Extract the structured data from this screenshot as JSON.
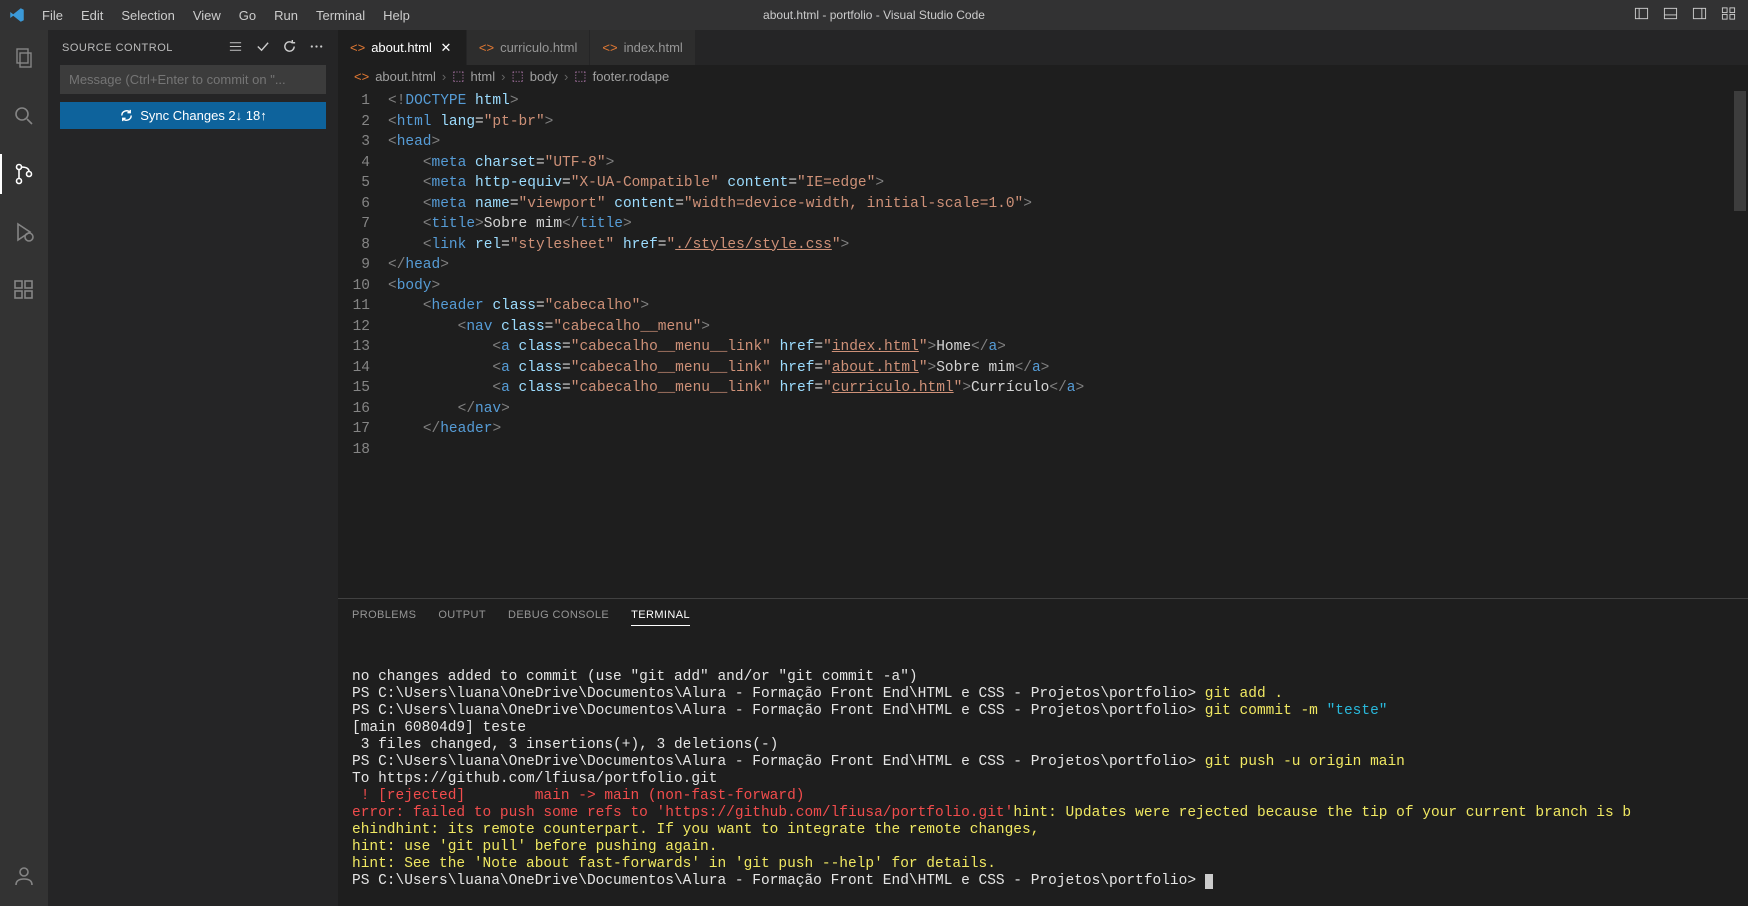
{
  "title": "about.html - portfolio - Visual Studio Code",
  "menu": [
    "File",
    "Edit",
    "Selection",
    "View",
    "Go",
    "Run",
    "Terminal",
    "Help"
  ],
  "sidebar": {
    "header": "SOURCE CONTROL",
    "commit_placeholder": "Message (Ctrl+Enter to commit on \"...",
    "sync_label": "Sync Changes 2↓ 18↑"
  },
  "tabs": [
    {
      "label": "about.html",
      "active": true,
      "close": true
    },
    {
      "label": "curriculo.html",
      "active": false,
      "close": false
    },
    {
      "label": "index.html",
      "active": false,
      "close": false
    }
  ],
  "breadcrumbs": [
    "about.html",
    "html",
    "body",
    "footer.rodape"
  ],
  "gutter_lines": [
    "1",
    "2",
    "3",
    "4",
    "5",
    "6",
    "7",
    "8",
    "9",
    "10",
    "11",
    "12",
    "13",
    "14",
    "15",
    "16",
    "17",
    "18"
  ],
  "panel_tabs": [
    "PROBLEMS",
    "OUTPUT",
    "DEBUG CONSOLE",
    "TERMINAL"
  ],
  "terminal": {
    "l1": "no changes added to commit (use \"git add\" and/or \"git commit -a\")",
    "l2a": "PS C:\\Users\\luana\\OneDrive\\Documentos\\Alura - Formação Front End\\HTML e CSS - Projetos\\portfolio> ",
    "l2b": "git add .",
    "l3a": "PS C:\\Users\\luana\\OneDrive\\Documentos\\Alura - Formação Front End\\HTML e CSS - Projetos\\portfolio> ",
    "l3b": "git commit -m ",
    "l3c": "\"teste\"",
    "l4": "[main 60804d9] teste",
    "l5": " 3 files changed, 3 insertions(+), 3 deletions(-)",
    "l6a": "PS C:\\Users\\luana\\OneDrive\\Documentos\\Alura - Formação Front End\\HTML e CSS - Projetos\\portfolio> ",
    "l6b": "git push -u origin main",
    "l7": "To https://github.com/lfiusa/portfolio.git",
    "l8": " ! [rejected]        main -> main (non-fast-forward)",
    "l9a": "error: failed to push some refs to 'https://github.com/lfiusa/portfolio.git'",
    "l9b": "hint: Updates were rejected because the tip of your current branch is b",
    "l10": "ehindhint: its remote counterpart. If you want to integrate the remote changes,",
    "l11": "hint: use 'git pull' before pushing again.",
    "l12": "hint: See the 'Note about fast-forwards' in 'git push --help' for details.",
    "l13": "PS C:\\Users\\luana\\OneDrive\\Documentos\\Alura - Formação Front End\\HTML e CSS - Projetos\\portfolio> "
  }
}
